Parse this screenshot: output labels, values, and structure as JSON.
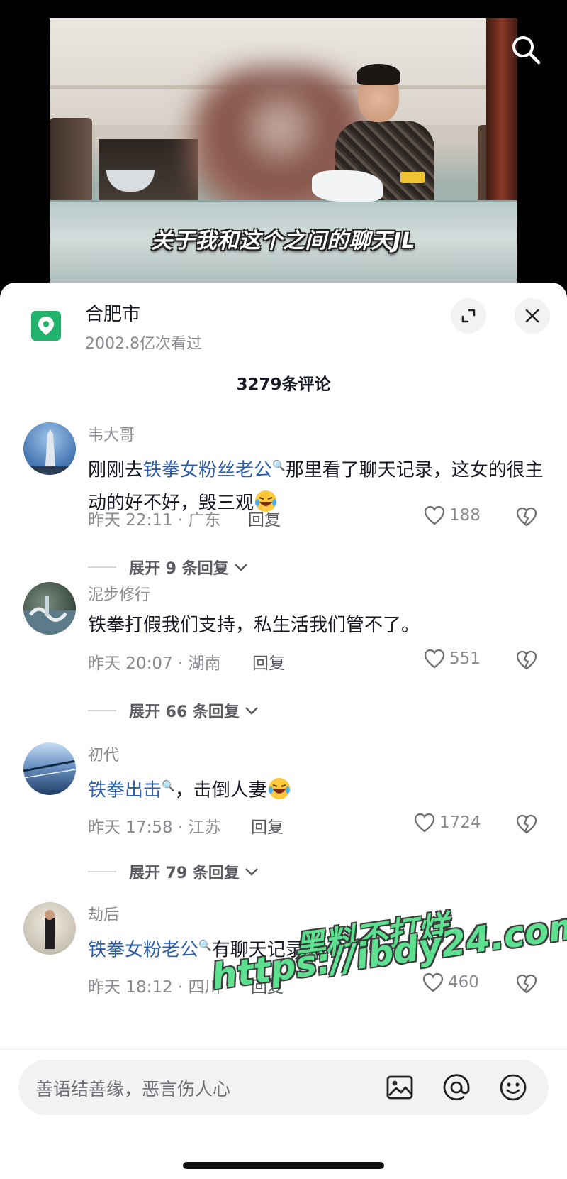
{
  "video": {
    "subtitle": "关于我和这个之间的聊天JL"
  },
  "header": {
    "location_title": "合肥市",
    "view_count": "2002.8亿次看过",
    "comment_count": "3279条评论"
  },
  "comments": [
    {
      "user": "韦大哥",
      "text_before": "刚刚去",
      "link": "铁拳女粉丝老公",
      "text_after": "那里看了聊天记录，这女的很主动的好不好，毁三观",
      "time_location": "昨天 22:11 · 广东",
      "reply_label": "回复",
      "likes": "188",
      "expand_label": "展开 9 条回复"
    },
    {
      "user": "泥步修行",
      "text_before": "铁拳打假我们支持，私生活我们管不了。",
      "link": "",
      "text_after": "",
      "time_location": "昨天 20:07 · 湖南",
      "reply_label": "回复",
      "likes": "551",
      "expand_label": "展开 66 条回复"
    },
    {
      "user": "初代",
      "text_before": "",
      "link": "铁拳出击",
      "text_after": "，击倒人妻",
      "time_location": "昨天 17:58 · 江苏",
      "reply_label": "回复",
      "likes": "1724",
      "expand_label": "展开 79 条回复"
    },
    {
      "user": "劫后",
      "text_before": "",
      "link": "铁拳女粉老公",
      "text_after": "有聊天记录",
      "time_location": "昨天 18:12 · 四川",
      "reply_label": "回复",
      "likes": "460"
    }
  ],
  "watermark": {
    "line1": "黑料不打烊",
    "line2": "https://ibdy24.com"
  },
  "input": {
    "placeholder": "善语结善缘，恶言伤人心"
  },
  "icons": {
    "search": "search-icon",
    "location": "location-pin-icon",
    "expand": "expand-icon",
    "close": "close-icon",
    "like": "heart-icon",
    "dislike": "broken-heart-icon",
    "image": "image-icon",
    "mention": "at-icon",
    "emoji": "emoji-icon"
  },
  "colors": {
    "link": "#2f5fa8",
    "location_badge": "#21b36c",
    "watermark": "#5de08f"
  }
}
